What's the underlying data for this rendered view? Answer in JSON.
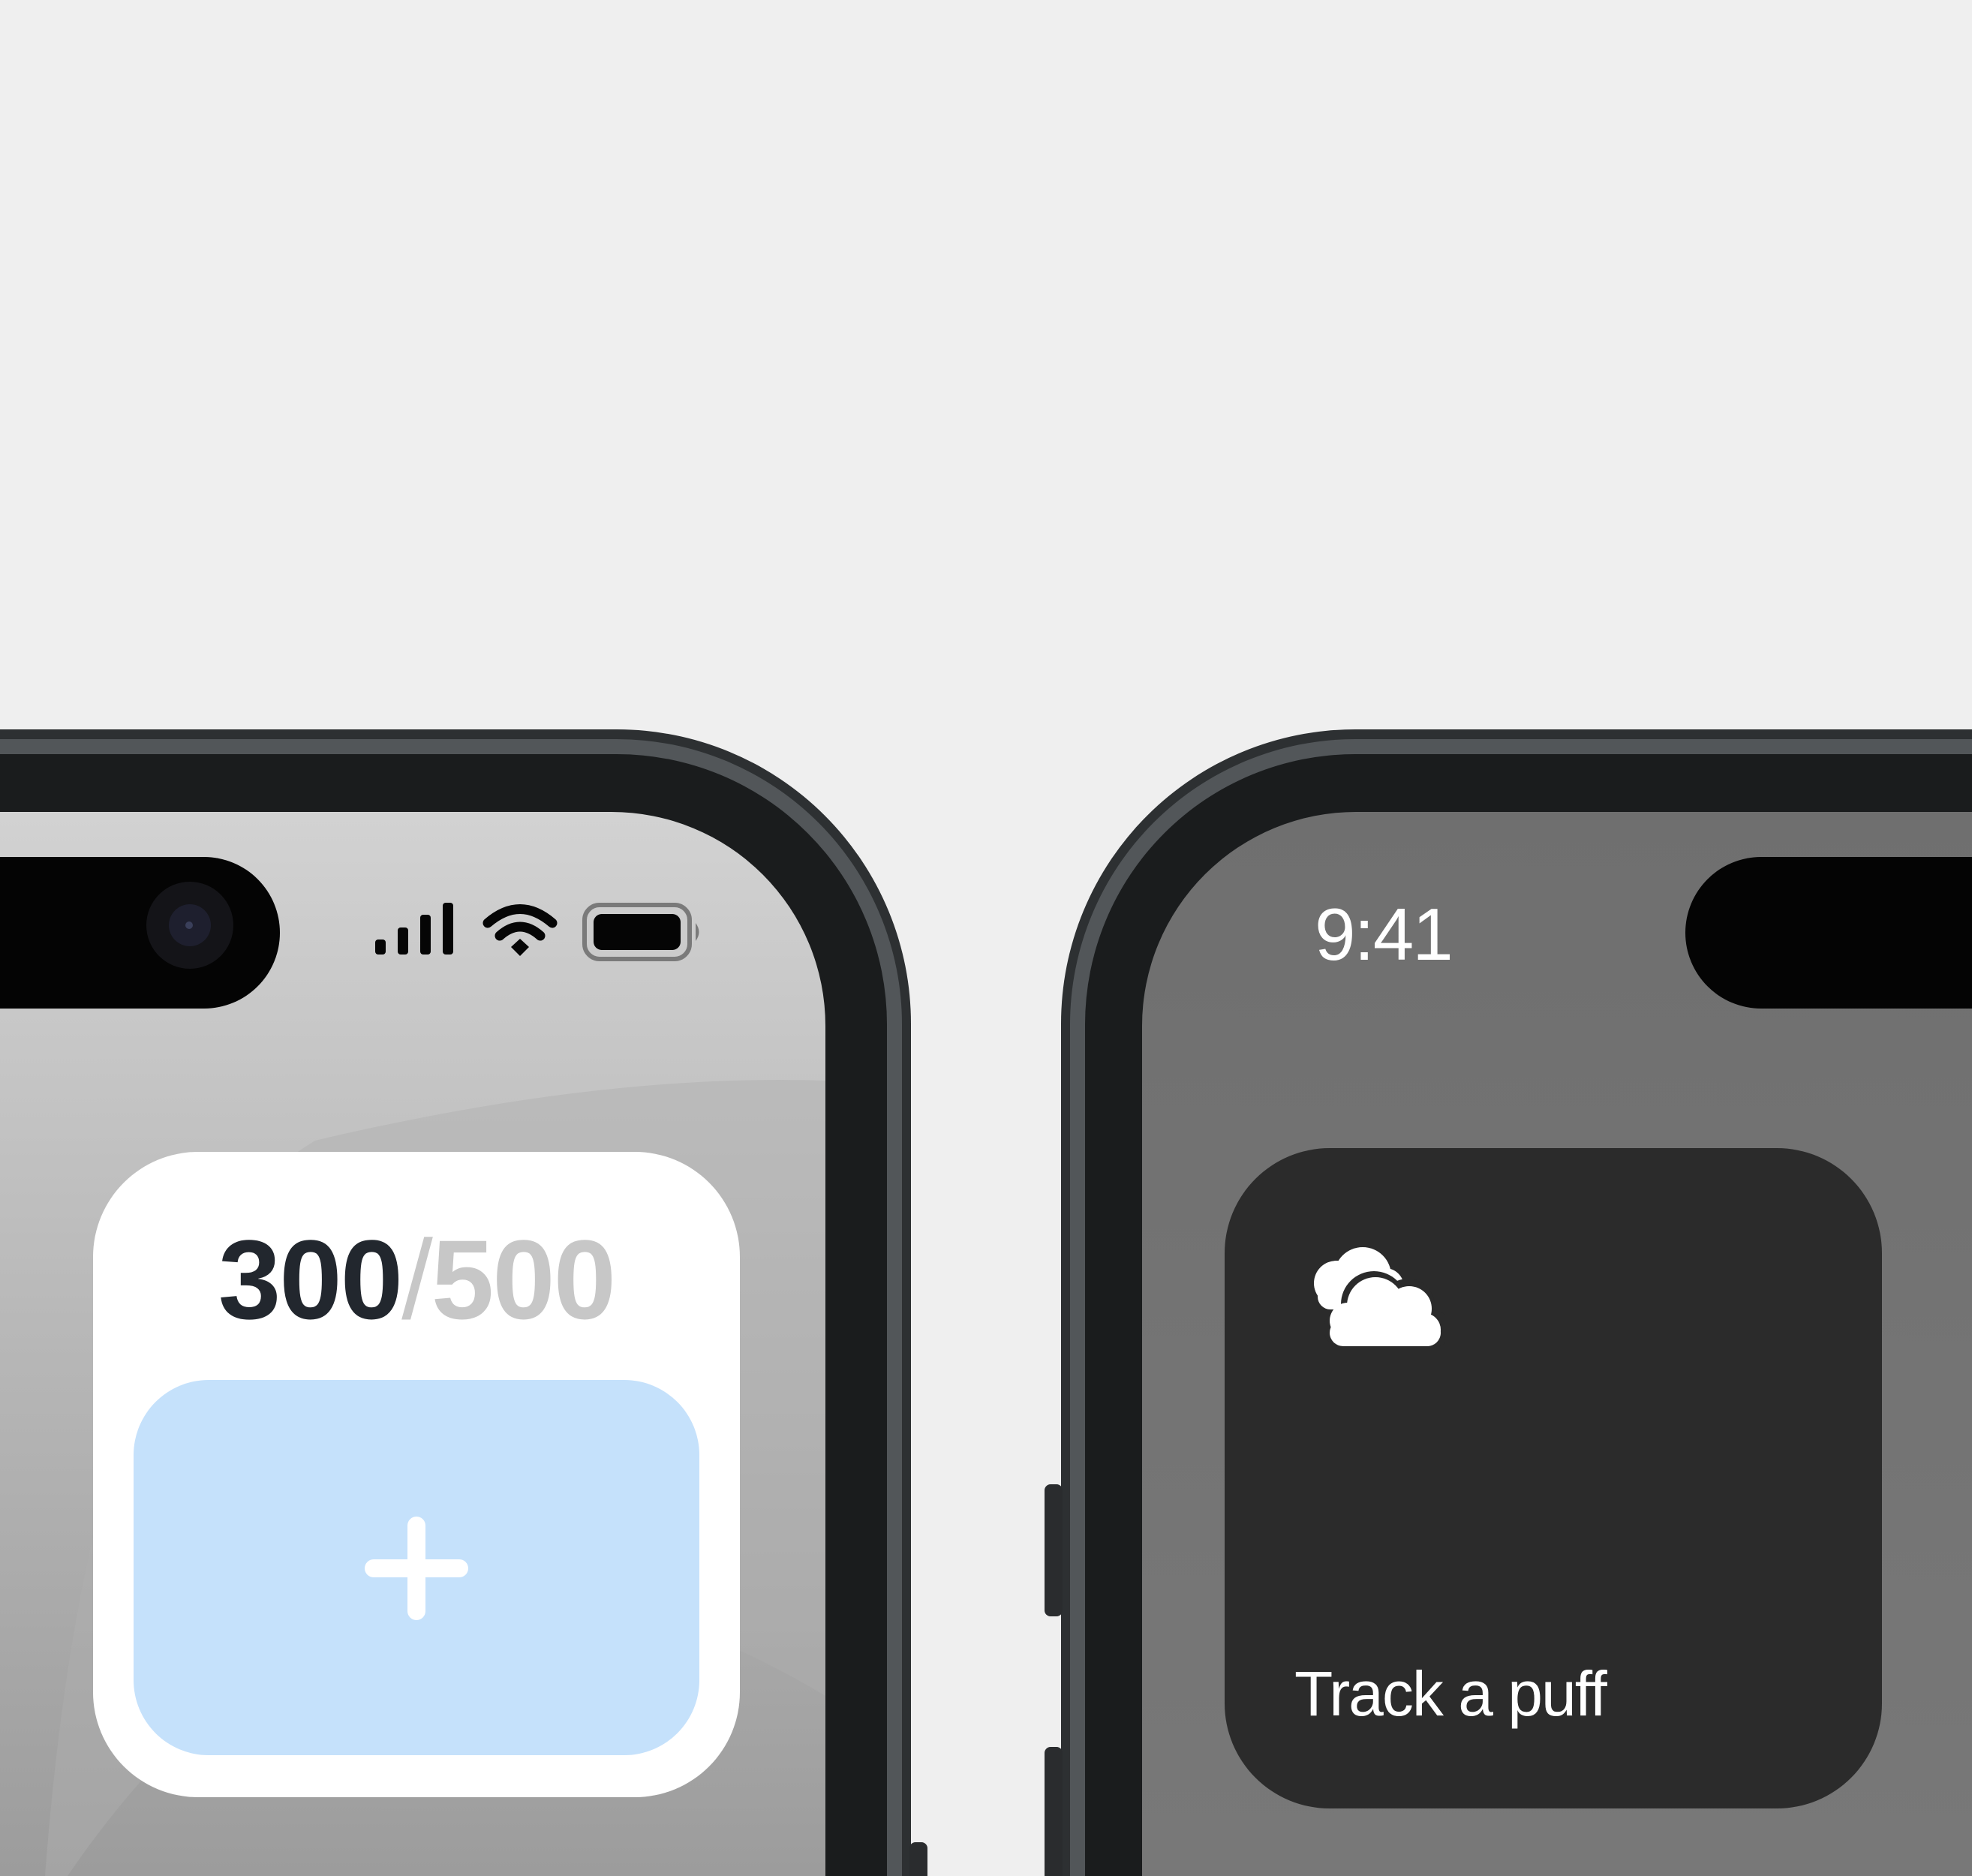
{
  "status_bar": {
    "time": "9:41"
  },
  "water_widget": {
    "current": "300",
    "separator": "/",
    "goal": "500"
  },
  "puff_widget": {
    "label": "Track a puff"
  },
  "icons": {
    "signal": "cellular-signal-icon",
    "wifi": "wifi-icon",
    "battery": "battery-icon",
    "camera": "front-camera-icon",
    "add": "plus-icon",
    "weather": "cloud-icon"
  },
  "colors": {
    "background": "#efefef",
    "phone_frame": "#1c1e1f",
    "screen_left": "#c4c4c4",
    "screen_right": "#707070",
    "add_button": "#c5e1fb",
    "dark_widget": "#2b2b2b"
  }
}
